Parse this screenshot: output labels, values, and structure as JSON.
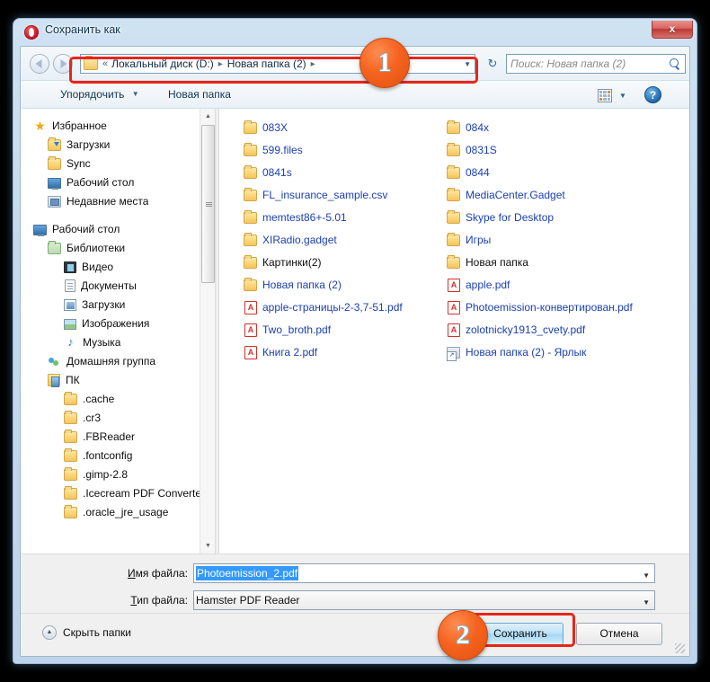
{
  "window": {
    "title": "Сохранить как",
    "logo_icon": "opera-logo-icon",
    "close_label": "x"
  },
  "nav": {
    "back_icon": "back-arrow-icon",
    "forward_icon": "forward-arrow-icon",
    "breadcrumb_chevron": "«",
    "breadcrumb": [
      {
        "label": "Локальный диск (D:)",
        "sep": "▸"
      },
      {
        "label": "Новая папка (2)",
        "sep": "▸"
      }
    ],
    "address_dropdown_icon": "chevron-down-icon",
    "refresh_icon": "↻",
    "search": {
      "placeholder": "Поиск: Новая папка (2)",
      "icon": "search-icon"
    }
  },
  "toolbar": {
    "organize_label": "Упорядочить",
    "organize_caret": "▼",
    "new_folder_label": "Новая папка",
    "view_icon": "view-grid-icon",
    "view_caret": "▼",
    "help_label": "?"
  },
  "sidebar": {
    "items": [
      {
        "label": "Избранное",
        "icon": "star-icon",
        "level": 0
      },
      {
        "label": "Загрузки",
        "icon": "folder-download-icon",
        "level": 1
      },
      {
        "label": "Sync",
        "icon": "folder-icon",
        "level": 1
      },
      {
        "label": "Рабочий стол",
        "icon": "desktop-icon",
        "level": 1
      },
      {
        "label": "Недавние места",
        "icon": "recent-places-icon",
        "level": 1
      },
      {
        "label": "",
        "icon": "gap",
        "level": 0
      },
      {
        "label": "Рабочий стол",
        "icon": "desktop-icon",
        "level": 0
      },
      {
        "label": "Библиотеки",
        "icon": "library-icon",
        "level": 1
      },
      {
        "label": "Видео",
        "icon": "video-icon",
        "level": 2
      },
      {
        "label": "Документы",
        "icon": "document-icon",
        "level": 2
      },
      {
        "label": "Загрузки",
        "icon": "downloads-icon",
        "level": 2
      },
      {
        "label": "Изображения",
        "icon": "pictures-icon",
        "level": 2
      },
      {
        "label": "Музыка",
        "icon": "music-icon",
        "level": 2
      },
      {
        "label": "Домашняя группа",
        "icon": "homegroup-icon",
        "level": 1
      },
      {
        "label": "ПК",
        "icon": "computer-icon",
        "level": 1
      },
      {
        "label": ".cache",
        "icon": "folder-icon",
        "level": 2
      },
      {
        "label": ".cr3",
        "icon": "folder-icon",
        "level": 2
      },
      {
        "label": ".FBReader",
        "icon": "folder-icon",
        "level": 2
      },
      {
        "label": ".fontconfig",
        "icon": "folder-icon",
        "level": 2
      },
      {
        "label": ".gimp-2.8",
        "icon": "folder-icon",
        "level": 2
      },
      {
        "label": ".Icecream PDF Converter",
        "icon": "folder-icon",
        "level": 2
      },
      {
        "label": ".oracle_jre_usage",
        "icon": "folder-icon",
        "level": 2
      }
    ],
    "scrollbar": {
      "up_icon": "▲",
      "down_icon": "▼"
    }
  },
  "filelist": {
    "column1": [
      {
        "label": "083X",
        "icon": "folder-icon",
        "link": true
      },
      {
        "label": "599.files",
        "icon": "folder-icon",
        "link": true
      },
      {
        "label": "0841s",
        "icon": "folder-icon",
        "link": true
      },
      {
        "label": "FL_insurance_sample.csv",
        "icon": "folder-icon",
        "link": true
      },
      {
        "label": "memtest86+-5.01",
        "icon": "folder-icon",
        "link": true
      },
      {
        "label": "XIRadio.gadget",
        "icon": "folder-icon",
        "link": true
      },
      {
        "label": "Картинки(2)",
        "icon": "folder-icon",
        "link": false
      },
      {
        "label": "Новая папка (2)",
        "icon": "folder-icon",
        "link": true
      },
      {
        "label": "apple-страницы-2-3,7-51.pdf",
        "icon": "pdf-icon",
        "link": true
      },
      {
        "label": "Two_broth.pdf",
        "icon": "pdf-icon",
        "link": true
      },
      {
        "label": "Книга 2.pdf",
        "icon": "pdf-icon",
        "link": true
      }
    ],
    "column2": [
      {
        "label": "084x",
        "icon": "folder-icon",
        "link": true
      },
      {
        "label": "0831S",
        "icon": "folder-icon",
        "link": true
      },
      {
        "label": "0844",
        "icon": "folder-icon",
        "link": true
      },
      {
        "label": "MediaCenter.Gadget",
        "icon": "folder-icon",
        "link": true
      },
      {
        "label": "Skype for Desktop",
        "icon": "folder-icon",
        "link": true
      },
      {
        "label": "Игры",
        "icon": "folder-icon",
        "link": true
      },
      {
        "label": "Новая папка",
        "icon": "folder-icon",
        "link": false
      },
      {
        "label": "apple.pdf",
        "icon": "pdf-icon",
        "link": true
      },
      {
        "label": "Photoemission-конвертирован.pdf",
        "icon": "pdf-icon",
        "link": true
      },
      {
        "label": "zolotnicky1913_cvety.pdf",
        "icon": "pdf-icon",
        "link": true
      },
      {
        "label": "Новая папка (2) - Ярлык",
        "icon": "shortcut-icon",
        "link": true
      }
    ],
    "pdf_glyph": "A"
  },
  "form": {
    "file_name_label": "Имя файла:",
    "file_name_underline": "И",
    "file_name_value": "Photoemission_2.pdf",
    "file_type_label": "Тип файла:",
    "file_type_underline": "Т",
    "file_type_value": "Hamster PDF Reader",
    "caret_icon": "▼"
  },
  "footer": {
    "hide_folders_label": "Скрыть папки",
    "hide_folders_icon": "▲",
    "save_label": "Сохранить",
    "cancel_label": "Отмена"
  },
  "annotations": {
    "badge1": "1",
    "badge2": "2",
    "highlight_color": "#e8251a"
  }
}
